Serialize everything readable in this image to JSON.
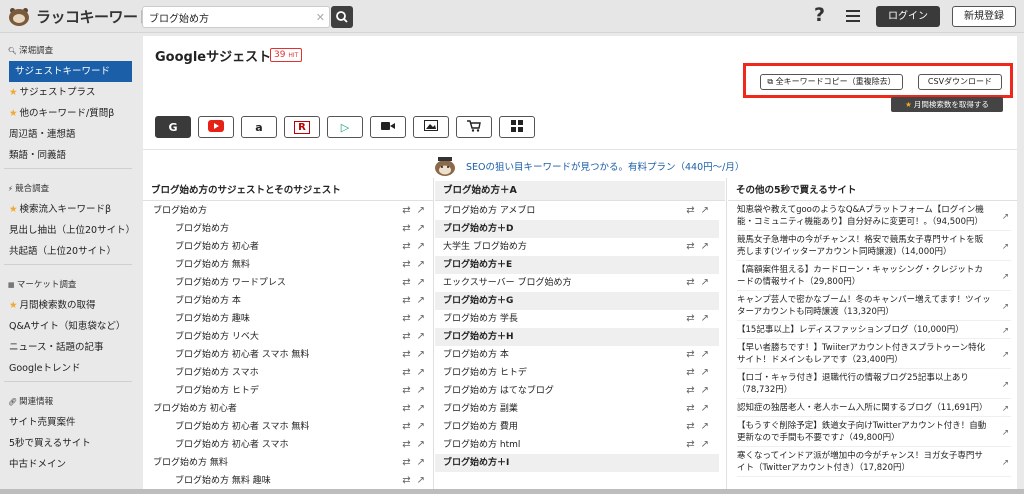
{
  "app": {
    "name": "ラッコキーワード"
  },
  "search": {
    "value": "ブログ始め方"
  },
  "header": {
    "help": "?",
    "login": "ログイン",
    "signup": "新規登録"
  },
  "sidebar": {
    "sections": [
      {
        "title": "深堀調査",
        "items": [
          {
            "label": "サジェストキーワード",
            "active": true,
            "star": false
          },
          {
            "label": "サジェストプラス",
            "star": true
          },
          {
            "label": "他のキーワード/質問β",
            "star": true
          },
          {
            "label": "周辺語・連想語",
            "star": false
          },
          {
            "label": "類語・同義語",
            "star": false
          }
        ]
      },
      {
        "title": "競合調査",
        "items": [
          {
            "label": "検索流入キーワードβ",
            "star": true
          },
          {
            "label": "見出し抽出（上位20サイト）",
            "star": false
          },
          {
            "label": "共起語（上位20サイト）",
            "star": false
          }
        ]
      },
      {
        "title": "マーケット調査",
        "items": [
          {
            "label": "月間検索数の取得",
            "star": true
          },
          {
            "label": "Q&Aサイト（知恵袋など）",
            "star": false
          },
          {
            "label": "ニュース・話題の記事",
            "star": false
          },
          {
            "label": "Googleトレンド",
            "star": false
          }
        ]
      },
      {
        "title": "関連情報",
        "items": [
          {
            "label": "サイト売買案件",
            "star": false
          },
          {
            "label": "5秒で買えるサイト",
            "star": false
          },
          {
            "label": "中古ドメイン",
            "star": false
          }
        ]
      }
    ]
  },
  "main": {
    "title": "Googleサジェスト",
    "hit_count": "39",
    "hit_unit": "HIT",
    "copy_all": "全キーワードコピー（重複除去）",
    "csv": "CSVダウンロード",
    "get_volume": "月間検索数を取得する",
    "promo": "SEOの狙い目キーワードが見つかる。有料プラン（440円〜/月）",
    "engines": [
      {
        "icon": "google-icon",
        "glyph": "G",
        "color": "#222"
      },
      {
        "icon": "youtube-icon",
        "glyph": "",
        "color": "#e62117"
      },
      {
        "icon": "amazon-icon",
        "glyph": "a",
        "color": "#222"
      },
      {
        "icon": "rakuten-icon",
        "glyph": "R",
        "color": "#bf0000"
      },
      {
        "icon": "bing-icon",
        "glyph": "▷",
        "color": "#1b9e77"
      },
      {
        "icon": "video-icon",
        "glyph": "",
        "color": "#222"
      },
      {
        "icon": "image-icon",
        "glyph": "",
        "color": "#222"
      },
      {
        "icon": "shopping-cart-icon",
        "glyph": "",
        "color": "#222"
      },
      {
        "icon": "grid-icon",
        "glyph": "",
        "color": "#222"
      }
    ]
  },
  "columns": {
    "col1_header": "ブログ始め方のサジェストとそのサジェスト",
    "col2_header": "ブログ始め方＋A",
    "col3_header": "その他の5秒で買えるサイト"
  },
  "col1_rows": [
    {
      "text": "ブログ始め方",
      "indent": 0
    },
    {
      "text": "ブログ始め方",
      "indent": 1
    },
    {
      "text": "ブログ始め方 初心者",
      "indent": 1
    },
    {
      "text": "ブログ始め方 無料",
      "indent": 1
    },
    {
      "text": "ブログ始め方 ワードプレス",
      "indent": 1
    },
    {
      "text": "ブログ始め方 本",
      "indent": 1
    },
    {
      "text": "ブログ始め方 趣味",
      "indent": 1
    },
    {
      "text": "ブログ始め方 リベ大",
      "indent": 1
    },
    {
      "text": "ブログ始め方 初心者 スマホ 無料",
      "indent": 1
    },
    {
      "text": "ブログ始め方 スマホ",
      "indent": 1
    },
    {
      "text": "ブログ始め方 ヒトデ",
      "indent": 1
    },
    {
      "text": "ブログ始め方 初心者",
      "indent": 0
    },
    {
      "text": "ブログ始め方 初心者 スマホ 無料",
      "indent": 1
    },
    {
      "text": "ブログ始め方 初心者 スマホ",
      "indent": 1
    },
    {
      "text": "ブログ始め方 無料",
      "indent": 0
    },
    {
      "text": "ブログ始め方 無料 趣味",
      "indent": 1
    }
  ],
  "col2_rows": [
    {
      "text": "ブログ始め方 アメブロ",
      "header": false
    },
    {
      "text": "ブログ始め方＋D",
      "header": true
    },
    {
      "text": "大学生 ブログ始め方",
      "header": false
    },
    {
      "text": "ブログ始め方＋E",
      "header": true
    },
    {
      "text": "エックスサーバー ブログ始め方",
      "header": false
    },
    {
      "text": "ブログ始め方＋G",
      "header": true
    },
    {
      "text": "ブログ始め方 学長",
      "header": false
    },
    {
      "text": "ブログ始め方＋H",
      "header": true
    },
    {
      "text": "ブログ始め方 本",
      "header": false
    },
    {
      "text": "ブログ始め方 ヒトデ",
      "header": false
    },
    {
      "text": "ブログ始め方 はてなブログ",
      "header": false
    },
    {
      "text": "ブログ始め方 副業",
      "header": false
    },
    {
      "text": "ブログ始め方 費用",
      "header": false
    },
    {
      "text": "ブログ始め方 html",
      "header": false
    },
    {
      "text": "ブログ始め方＋I",
      "header": true
    }
  ],
  "col3_rows": [
    "知恵袋や教えてgooのようなQ&Aプラットフォーム【ログイン機能・コミュニティ機能あり】自分好みに変更可！。（94,500円）",
    "競馬女子急増中の今がチャンス！格安で競馬女子専門サイトを販売します(ツイッターアカウント同時譲渡)（14,000円）",
    "【高額案件狙える】カードローン・キャッシング・クレジットカードの情報サイト（29,800円）",
    "キャンプ芸人で密かなブーム！冬のキャンパー増えてます！ツイッターアカウントも同時譲渡（13,320円）",
    "【15記事以上】レディスファッションブログ（10,000円）",
    "【早い者勝ちです！】Twiiterアカウント付きスプラトゥーン特化サイト！ドメインもレアです（23,400円）",
    "【ロゴ・キャラ付き】退職代行の情報ブログ25記事以上あり（78,732円）",
    "認知症の独居老人・老人ホーム入所に関するブログ（11,691円）",
    "【もうすぐ削除予定】鉄道女子向けTwitterアカウント付き！自動更新なので手間も不要です♪（49,800円）",
    "寒くなってインドア派が増加中の今がチャンス！ヨガ女子専門サイト（Twitterアカウント付き）（17,820円）"
  ]
}
